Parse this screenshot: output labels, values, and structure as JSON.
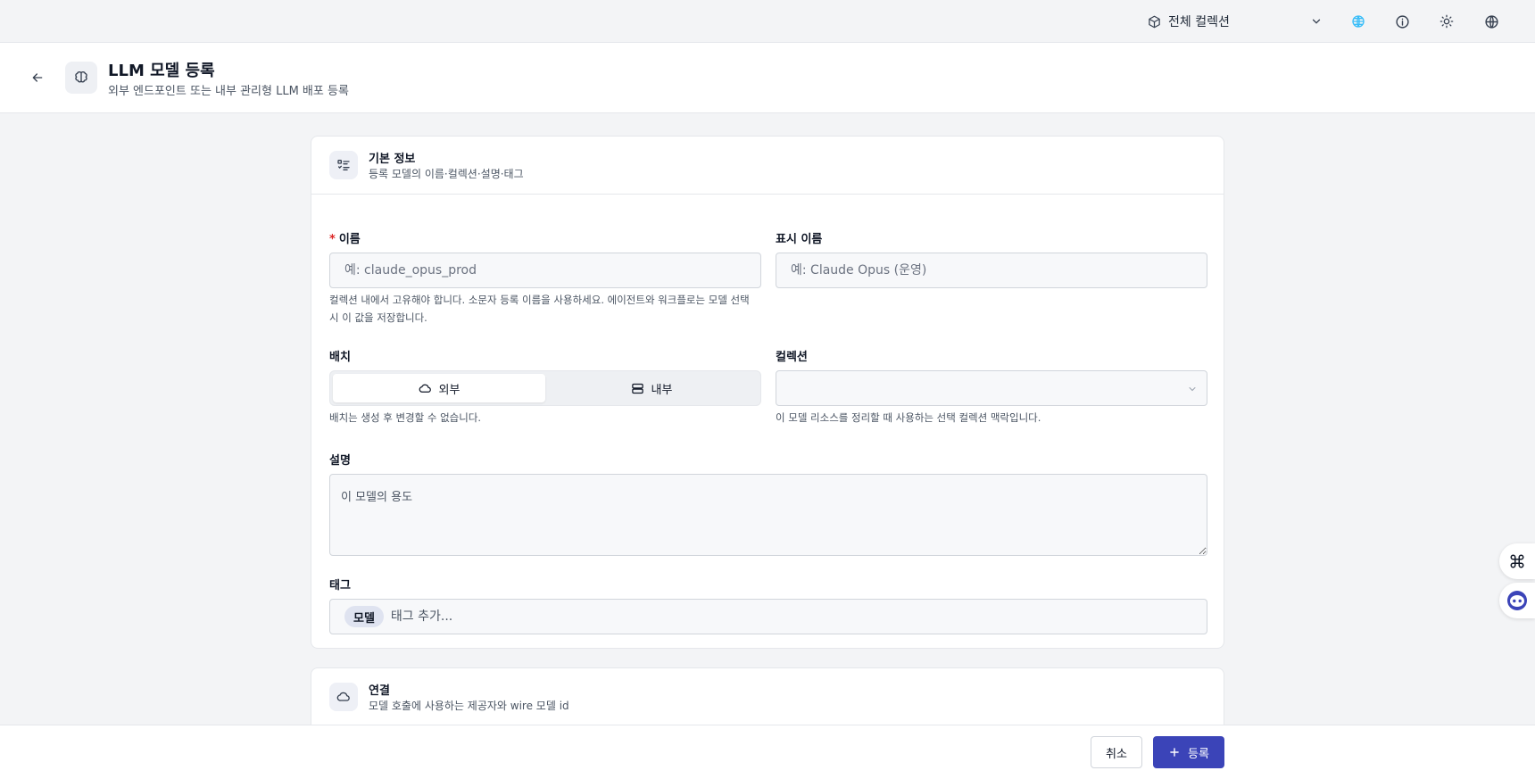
{
  "topbar": {
    "collection_label": "전체 컬렉션",
    "icons": [
      "cube-icon",
      "chevron-down-icon",
      "brain-status-icon",
      "info-icon",
      "sun-icon",
      "globe-icon"
    ],
    "accent_color": "#38bdf8"
  },
  "header": {
    "title": "LLM 모델 등록",
    "subtitle": "외부 엔드포인트 또는 내부 관리형 LLM 배포 등록"
  },
  "basic_info": {
    "title": "기본 정보",
    "subtitle": "등록 모델의 이름·컬렉션·설명·태그",
    "name": {
      "required_mark": "*",
      "label": "이름",
      "placeholder": "예: claude_opus_prod",
      "help": "컬렉션 내에서 고유해야 합니다. 소문자 등록 이름을 사용하세요. 에이전트와 워크플로는 모델 선택 시 이 값을 저장합니다."
    },
    "display_name": {
      "label": "표시 이름",
      "placeholder": "예: Claude Opus (운영)"
    },
    "deployment": {
      "label": "배치",
      "options": [
        "외부",
        "내부"
      ],
      "selected": "외부",
      "help": "배치는 생성 후 변경할 수 없습니다."
    },
    "collection": {
      "label": "컬렉션",
      "value": "",
      "help": "이 모델 리소스를 정리할 때 사용하는 선택 컬렉션 맥락입니다."
    },
    "description": {
      "label": "설명",
      "placeholder": "이 모델의 용도"
    },
    "tags": {
      "label": "태그",
      "items": [
        "모델"
      ],
      "placeholder": "태그 추가..."
    }
  },
  "connection": {
    "title": "연결",
    "subtitle": "모델 호출에 사용하는 제공자와 wire 모델 id"
  },
  "footer": {
    "cancel_label": "취소",
    "submit_label": "등록",
    "primary_color": "#3b44b8"
  }
}
